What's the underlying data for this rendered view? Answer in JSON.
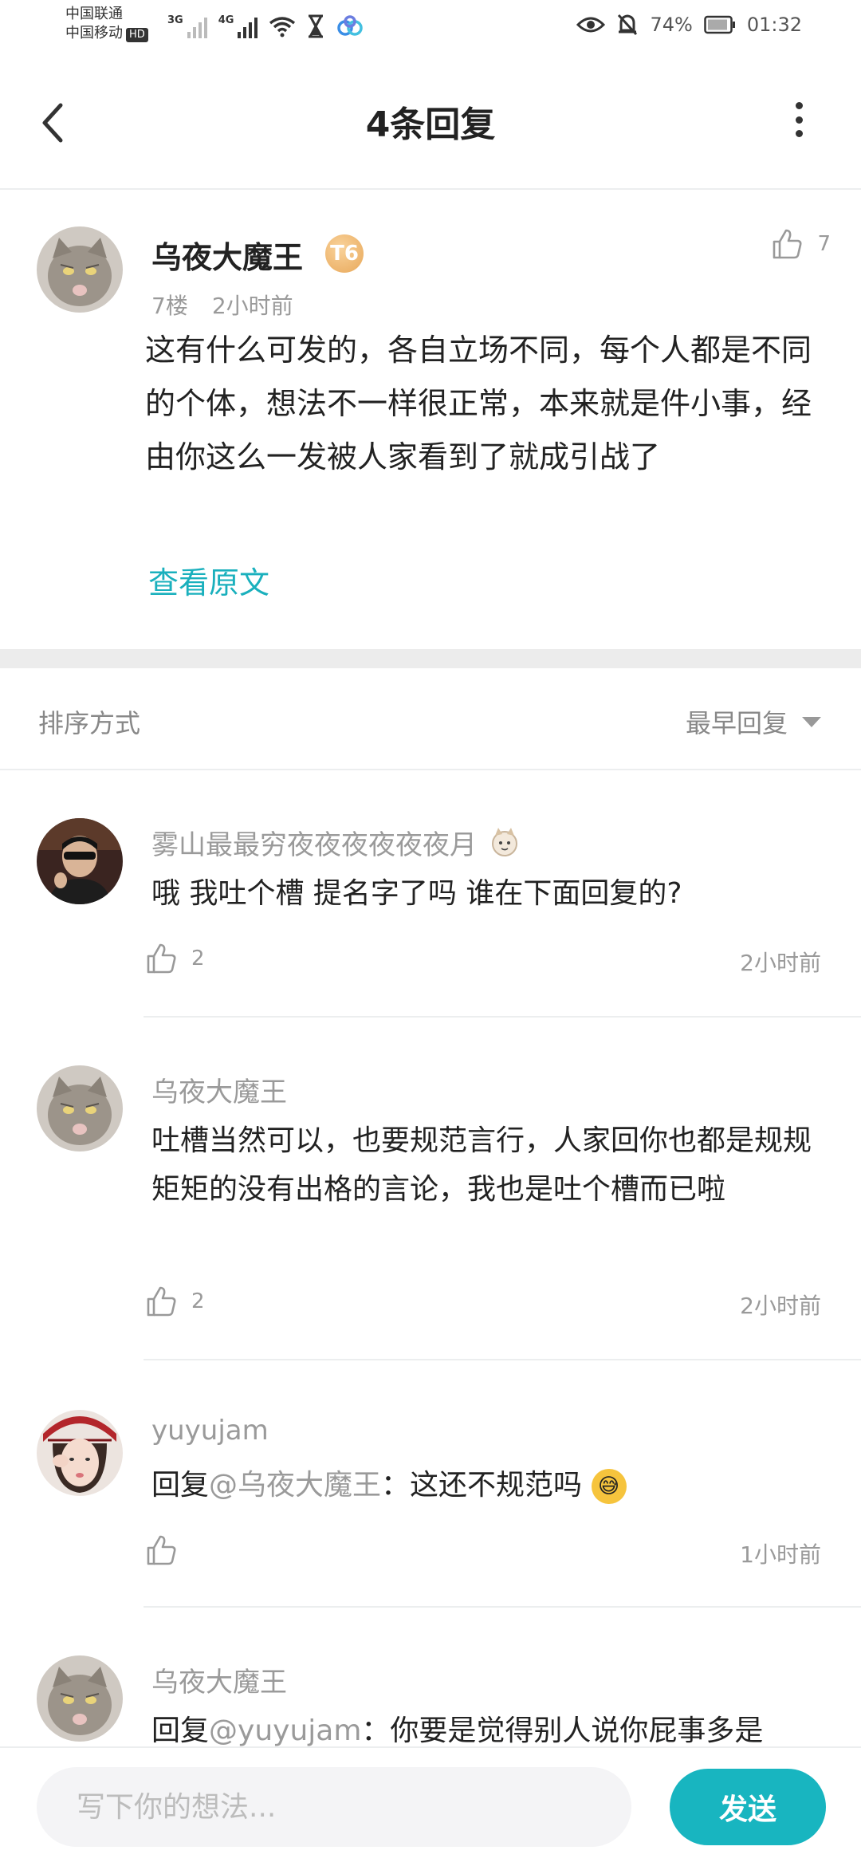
{
  "status_bar": {
    "carrier_1": "中国联通",
    "carrier_2": "中国移动",
    "hd": "HD",
    "net_1": "3G",
    "net_2": "4G",
    "battery": "74%",
    "time": "01:32"
  },
  "header": {
    "title": "4条回复"
  },
  "original_comment": {
    "author": "乌夜大魔王",
    "level_badge": "T6",
    "floor": "7楼",
    "time": "2小时前",
    "likes": "7",
    "content": "这有什么可发的，各自立场不同，每个人都是不同的个体，想法不一样很正常，本来就是件小事，经由你这么一发被人家看到了就成引战了",
    "view_original_label": "查看原文"
  },
  "sort": {
    "label": "排序方式",
    "selected": "最早回复"
  },
  "replies": [
    {
      "author": "雾山最最穷夜夜夜夜夜夜月",
      "content": "哦 我吐个槽 提名字了吗 谁在下面回复的?",
      "likes": "2",
      "time": "2小时前"
    },
    {
      "author": "乌夜大魔王",
      "content": "吐槽当然可以，也要规范言行，人家回你也都是规规矩矩的没有出格的言论，我也是吐个槽而已啦",
      "likes": "2",
      "time": "2小时前"
    },
    {
      "author": "yuyujam",
      "reply_prefix": "回复",
      "mention": "@乌夜大魔王",
      "content": "：这还不规范吗",
      "likes": "",
      "time": "1小时前"
    },
    {
      "author": "乌夜大魔王",
      "reply_prefix": "回复",
      "mention": "@yuyujam",
      "content": "：你要是觉得别人说你屁事多是"
    }
  ],
  "bottom_bar": {
    "input_placeholder": "写下你的想法...",
    "send_label": "发送"
  },
  "colors": {
    "accent": "#18b5c0",
    "link": "#1ab0bd",
    "muted_text": "#9a9a9a",
    "divider": "#eceeef"
  },
  "icons": [
    "back-arrow-icon",
    "more-vertical-icon",
    "thumbs-up-icon",
    "dropdown-caret-icon",
    "eye-icon",
    "bell-off-icon",
    "wifi-icon",
    "battery-icon"
  ]
}
